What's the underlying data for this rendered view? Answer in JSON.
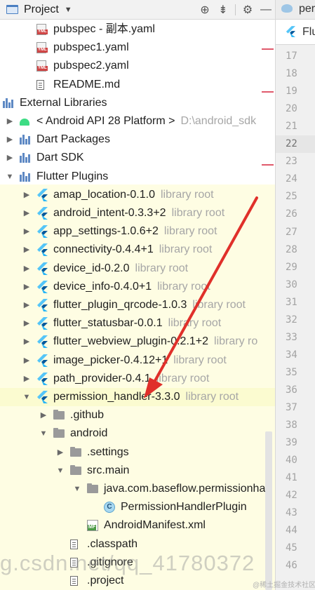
{
  "toolbar": {
    "title": "Project",
    "icons": [
      "crosshair-icon",
      "collapse-icon",
      "gear-icon",
      "minimize-icon"
    ]
  },
  "editor": {
    "tab_top": "per",
    "tab_file": "Flu",
    "line_numbers": [
      "17",
      "18",
      "19",
      "20",
      "21",
      "22",
      "23",
      "24",
      "25",
      "26",
      "27",
      "28",
      "29",
      "30",
      "31",
      "32",
      "33",
      "34",
      "35",
      "36",
      "37",
      "38",
      "39",
      "40",
      "41",
      "42",
      "43",
      "44",
      "45",
      "46"
    ],
    "current_line": "22"
  },
  "tree": {
    "items": [
      {
        "label": "pubspec - 副本.yaml",
        "icon": "yml",
        "depth": 2
      },
      {
        "label": "pubspec1.yaml",
        "icon": "yml",
        "depth": 2
      },
      {
        "label": "pubspec2.yaml",
        "icon": "yml",
        "depth": 2
      },
      {
        "label": "README.md",
        "icon": "md",
        "depth": 2
      },
      {
        "label": "External Libraries",
        "icon": "libs",
        "depth": 0,
        "arrow": "open"
      },
      {
        "label": "< Android API 28 Platform >",
        "sub": "D:\\android_sdk",
        "icon": "android",
        "depth": 1,
        "arrow": "closed"
      },
      {
        "label": "Dart Packages",
        "icon": "lib",
        "depth": 1,
        "arrow": "closed"
      },
      {
        "label": "Dart SDK",
        "icon": "lib",
        "depth": 1,
        "arrow": "closed"
      },
      {
        "label": "Flutter Plugins",
        "icon": "lib",
        "depth": 1,
        "arrow": "open"
      },
      {
        "label": "amap_location-0.1.0",
        "sub": "library root",
        "icon": "flutter",
        "depth": 2,
        "arrow": "closed"
      },
      {
        "label": "android_intent-0.3.3+2",
        "sub": "library root",
        "icon": "flutter",
        "depth": 2,
        "arrow": "closed"
      },
      {
        "label": "app_settings-1.0.6+2",
        "sub": "library root",
        "icon": "flutter",
        "depth": 2,
        "arrow": "closed"
      },
      {
        "label": "connectivity-0.4.4+1",
        "sub": "library root",
        "icon": "flutter",
        "depth": 2,
        "arrow": "closed"
      },
      {
        "label": "device_id-0.2.0",
        "sub": "library root",
        "icon": "flutter",
        "depth": 2,
        "arrow": "closed"
      },
      {
        "label": "device_info-0.4.0+1",
        "sub": "library root",
        "icon": "flutter",
        "depth": 2,
        "arrow": "closed"
      },
      {
        "label": "flutter_plugin_qrcode-1.0.3",
        "sub": "library root",
        "icon": "flutter",
        "depth": 2,
        "arrow": "closed"
      },
      {
        "label": "flutter_statusbar-0.0.1",
        "sub": "library root",
        "icon": "flutter",
        "depth": 2,
        "arrow": "closed"
      },
      {
        "label": "flutter_webview_plugin-0.2.1+2",
        "sub": "library ro",
        "icon": "flutter",
        "depth": 2,
        "arrow": "closed"
      },
      {
        "label": "image_picker-0.4.12+1",
        "sub": "library root",
        "icon": "flutter",
        "depth": 2,
        "arrow": "closed"
      },
      {
        "label": "path_provider-0.4.1",
        "sub": "library root",
        "icon": "flutter",
        "depth": 2,
        "arrow": "closed"
      },
      {
        "label": "permission_handler-3.3.0",
        "sub": "library root",
        "icon": "flutter",
        "depth": 2,
        "arrow": "open"
      },
      {
        "label": ".github",
        "icon": "folder",
        "depth": 3,
        "arrow": "closed"
      },
      {
        "label": "android",
        "icon": "folder",
        "depth": 3,
        "arrow": "open"
      },
      {
        "label": ".settings",
        "icon": "folder",
        "depth": 4,
        "arrow": "closed"
      },
      {
        "label": "src.main",
        "icon": "folder",
        "depth": 4,
        "arrow": "open"
      },
      {
        "label": "java.com.baseflow.permissionha",
        "icon": "folder",
        "depth": 5,
        "arrow": "open"
      },
      {
        "label": "PermissionHandlerPlugin",
        "icon": "class",
        "depth": 6
      },
      {
        "label": "AndroidManifest.xml",
        "icon": "mf",
        "depth": 5
      },
      {
        "label": ".classpath",
        "icon": "md",
        "depth": 4
      },
      {
        "label": ".gitignore",
        "icon": "md",
        "depth": 4
      },
      {
        "label": ".project",
        "icon": "md",
        "depth": 4
      }
    ]
  },
  "watermark": "g.csdn.net/qq_41780372",
  "watermark_small": "@稀土掘金技术社区",
  "colors": {
    "annotation_arrow": "#e0302a",
    "highlight": "#fefde3",
    "accent": "#4a7fc1"
  }
}
